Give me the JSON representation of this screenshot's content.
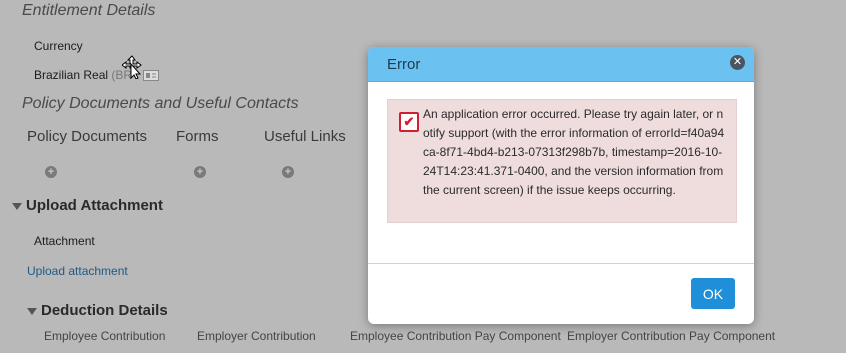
{
  "background": {
    "entitlement_title": "Entitlement Details",
    "currency_label": "Currency",
    "currency_value": "Brazilian Real",
    "currency_code": "(BR",
    "policy_title": "Policy Documents and Useful Contacts",
    "columns": [
      "Policy Documents",
      "Forms",
      "Useful Links"
    ],
    "upload_title": "Upload Attachment",
    "attachment_label": "Attachment",
    "upload_link": "Upload attachment",
    "deduction_title": "Deduction Details",
    "deduction_columns": [
      "Employee Contribution",
      "Employer Contribution",
      "Employee Contribution Pay Component",
      "Employer Contribution Pay Component"
    ]
  },
  "dialog": {
    "title": "Error",
    "message": "An application error occurred. Please try again later, or notify support (with the error information of errorId=f40a94ca-8f71-4bd4-b213-07313f298b7b, timestamp=2016-10-24T14:23:41.371-0400, and the version information from the current screen) if the issue keeps occurring.",
    "ok_label": "OK"
  },
  "icons": {
    "close": "close-icon",
    "error": "error-checkbox-icon",
    "add": "plus-circle-icon",
    "expand": "caret-down-icon",
    "cursor": "move-cursor-icon",
    "card": "id-card-icon"
  },
  "colors": {
    "header": "#6bc1ef",
    "ok_button": "#1f8fd9",
    "error_bg": "#efdcdc",
    "error_red": "#d01f2f",
    "overlay": "#b9b9b9"
  }
}
